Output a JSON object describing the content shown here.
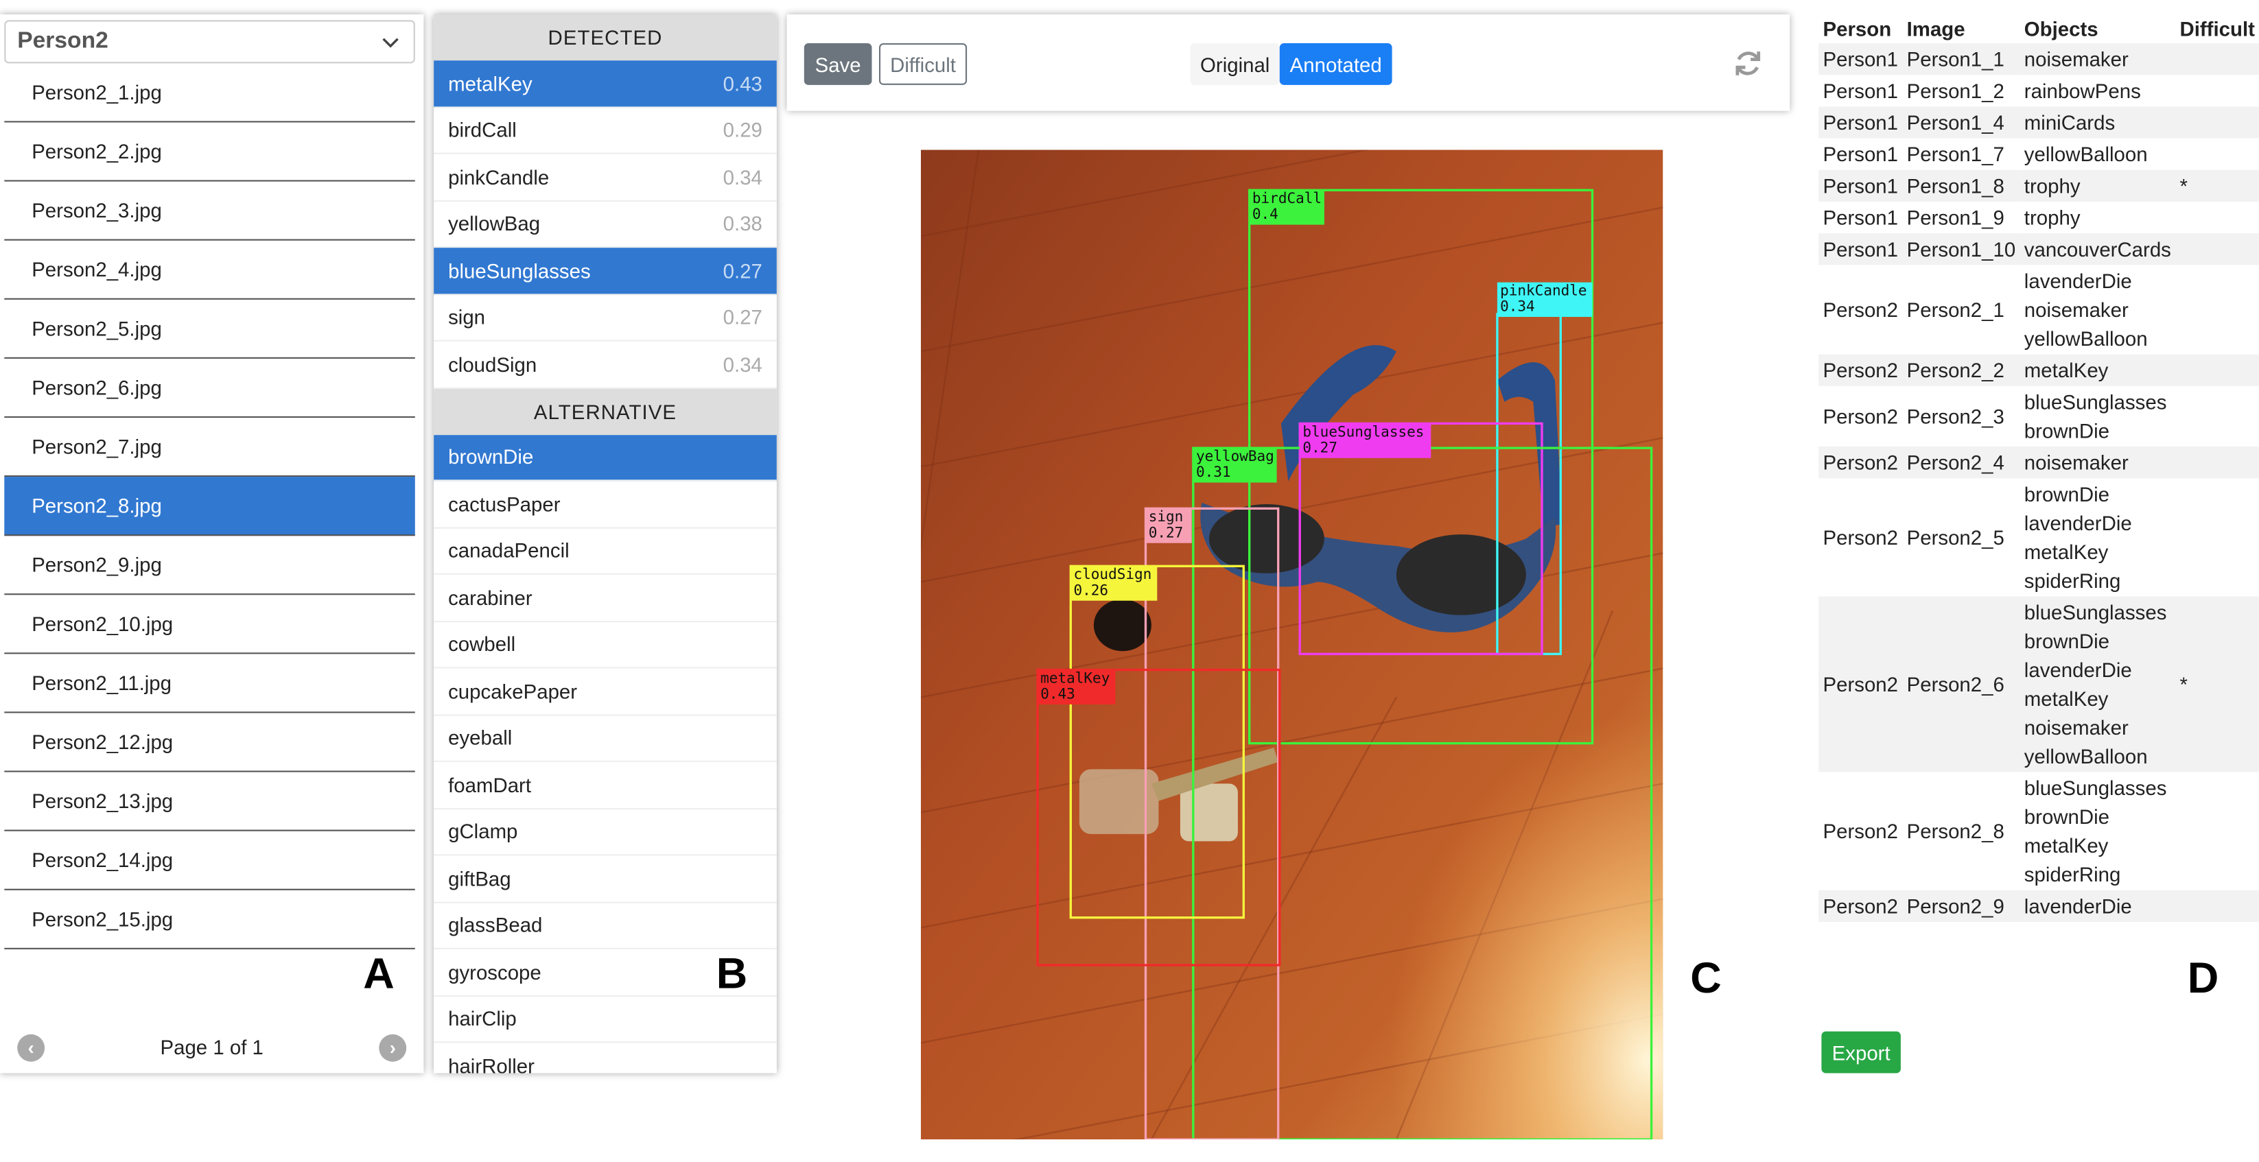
{
  "panelA": {
    "person_selected": "Person2",
    "images": [
      "Person2_1.jpg",
      "Person2_2.jpg",
      "Person2_3.jpg",
      "Person2_4.jpg",
      "Person2_5.jpg",
      "Person2_6.jpg",
      "Person2_7.jpg",
      "Person2_8.jpg",
      "Person2_9.jpg",
      "Person2_10.jpg",
      "Person2_11.jpg",
      "Person2_12.jpg",
      "Person2_13.jpg",
      "Person2_14.jpg",
      "Person2_15.jpg"
    ],
    "selected_image": "Person2_8.jpg",
    "page_text": "Page 1 of 1",
    "letter": "A"
  },
  "panelB": {
    "detected_header": "DETECTED",
    "detected": [
      {
        "name": "metalKey",
        "score": "0.43",
        "selected": true
      },
      {
        "name": "birdCall",
        "score": "0.29",
        "selected": false
      },
      {
        "name": "pinkCandle",
        "score": "0.34",
        "selected": false
      },
      {
        "name": "yellowBag",
        "score": "0.38",
        "selected": false
      },
      {
        "name": "blueSunglasses",
        "score": "0.27",
        "selected": true
      },
      {
        "name": "sign",
        "score": "0.27",
        "selected": false
      },
      {
        "name": "cloudSign",
        "score": "0.34",
        "selected": false
      }
    ],
    "alternative_header": "ALTERNATIVE",
    "alternative": [
      {
        "name": "brownDie",
        "selected": true
      },
      {
        "name": "cactusPaper",
        "selected": false
      },
      {
        "name": "canadaPencil",
        "selected": false
      },
      {
        "name": "carabiner",
        "selected": false
      },
      {
        "name": "cowbell",
        "selected": false
      },
      {
        "name": "cupcakePaper",
        "selected": false
      },
      {
        "name": "eyeball",
        "selected": false
      },
      {
        "name": "foamDart",
        "selected": false
      },
      {
        "name": "gClamp",
        "selected": false
      },
      {
        "name": "giftBag",
        "selected": false
      },
      {
        "name": "glassBead",
        "selected": false
      },
      {
        "name": "gyroscope",
        "selected": false
      },
      {
        "name": "hairClip",
        "selected": false
      },
      {
        "name": "hairRoller",
        "selected": false
      }
    ],
    "letter": "B"
  },
  "toolbar": {
    "save": "Save",
    "difficult": "Difficult",
    "original": "Original",
    "annotated": "Annotated",
    "active_view": "Annotated"
  },
  "image_annotations": [
    {
      "name": "birdCall",
      "score": "0.4",
      "color": "#3cf23c"
    },
    {
      "name": "pinkCandle",
      "score": "0.34",
      "color": "#3ff5f5"
    },
    {
      "name": "blueSunglasses",
      "score": "0.27",
      "color": "#f03cf0"
    },
    {
      "name": "yellowBag",
      "score": "0.31",
      "color": "#3cf23c"
    },
    {
      "name": "sign",
      "score": "0.27",
      "color": "#f7a0b4"
    },
    {
      "name": "cloudSign",
      "score": "0.26",
      "color": "#f5f53c"
    },
    {
      "name": "metalKey",
      "score": "0.43",
      "color": "#f02a2a"
    }
  ],
  "panelC_letter": "C",
  "panelD": {
    "headers": [
      "Person",
      "Image",
      "Objects",
      "Difficult"
    ],
    "rows": [
      {
        "person": "Person1",
        "image": "Person1_1",
        "objects": [
          "noisemaker"
        ],
        "difficult": ""
      },
      {
        "person": "Person1",
        "image": "Person1_2",
        "objects": [
          "rainbowPens"
        ],
        "difficult": ""
      },
      {
        "person": "Person1",
        "image": "Person1_4",
        "objects": [
          "miniCards"
        ],
        "difficult": ""
      },
      {
        "person": "Person1",
        "image": "Person1_7",
        "objects": [
          "yellowBalloon"
        ],
        "difficult": ""
      },
      {
        "person": "Person1",
        "image": "Person1_8",
        "objects": [
          "trophy"
        ],
        "difficult": "*"
      },
      {
        "person": "Person1",
        "image": "Person1_9",
        "objects": [
          "trophy"
        ],
        "difficult": ""
      },
      {
        "person": "Person1",
        "image": "Person1_10",
        "objects": [
          "vancouverCards"
        ],
        "difficult": ""
      },
      {
        "person": "Person2",
        "image": "Person2_1",
        "objects": [
          "lavenderDie",
          "noisemaker",
          "yellowBalloon"
        ],
        "difficult": ""
      },
      {
        "person": "Person2",
        "image": "Person2_2",
        "objects": [
          "metalKey"
        ],
        "difficult": ""
      },
      {
        "person": "Person2",
        "image": "Person2_3",
        "objects": [
          "blueSunglasses",
          "brownDie"
        ],
        "difficult": ""
      },
      {
        "person": "Person2",
        "image": "Person2_4",
        "objects": [
          "noisemaker"
        ],
        "difficult": ""
      },
      {
        "person": "Person2",
        "image": "Person2_5",
        "objects": [
          "brownDie",
          "lavenderDie",
          "metalKey",
          "spiderRing"
        ],
        "difficult": ""
      },
      {
        "person": "Person2",
        "image": "Person2_6",
        "objects": [
          "blueSunglasses",
          "brownDie",
          "lavenderDie",
          "metalKey",
          "noisemaker",
          "yellowBalloon"
        ],
        "difficult": "*"
      },
      {
        "person": "Person2",
        "image": "Person2_8",
        "objects": [
          "blueSunglasses",
          "brownDie",
          "metalKey",
          "spiderRing"
        ],
        "difficult": ""
      },
      {
        "person": "Person2",
        "image": "Person2_9",
        "objects": [
          "lavenderDie"
        ],
        "difficult": ""
      }
    ],
    "export": "Export",
    "letter": "D"
  }
}
